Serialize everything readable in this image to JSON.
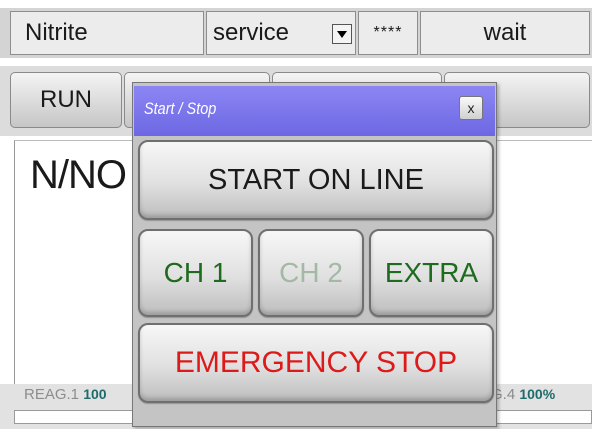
{
  "header": {
    "parameter": "Nitrite",
    "mode": "service",
    "password_mask": "****",
    "status": "wait"
  },
  "toolbar": {
    "run_label": "RUN"
  },
  "display": {
    "parameter_formula": "N/NO"
  },
  "reagents": {
    "reag1_label": "REAG.1",
    "reag1_level": "100",
    "reag4_label": "G.4",
    "reag4_level": "100%"
  },
  "dialog": {
    "title": "Start / Stop",
    "close_label": "x",
    "start_online_label": "START ON LINE",
    "ch1_label": "CH 1",
    "ch2_label": "CH 2",
    "extra_label": "EXTRA",
    "emergency_stop_label": "EMERGENCY STOP"
  },
  "colors": {
    "title_bar": "#7a74ec",
    "channel_enabled": "#1e6b1e",
    "channel_disabled": "#a4b9a4",
    "emergency": "#dd1a1a"
  }
}
